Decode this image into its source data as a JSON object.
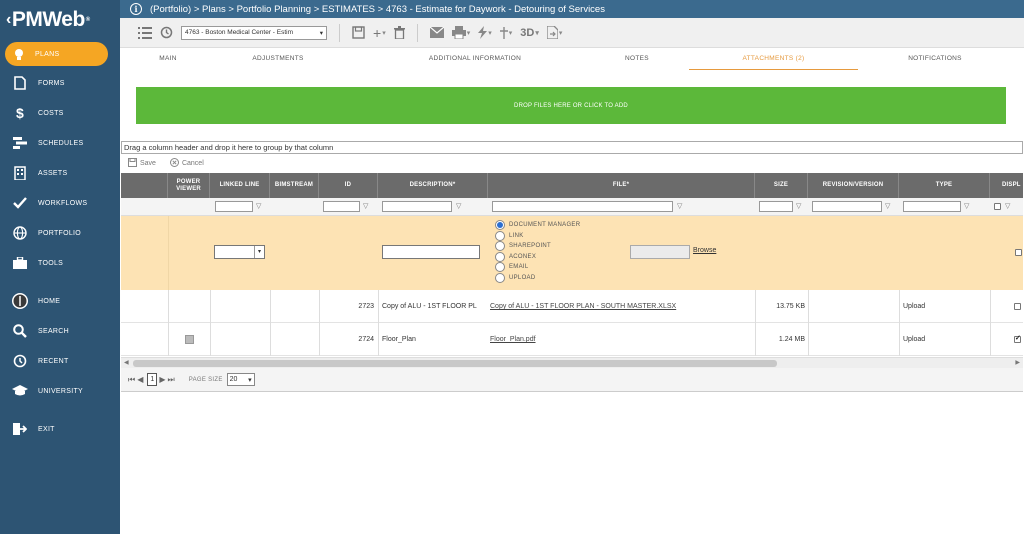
{
  "app": {
    "logo_prefix": "‹",
    "logo_text": "PMWeb",
    "logo_mark": "®"
  },
  "breadcrumb": "(Portfolio) > Plans > Portfolio Planning > ESTIMATES > 4763 - Estimate for Daywork - Detouring of Services",
  "sidebar": {
    "items": [
      {
        "label": "PLANS",
        "icon": "lightbulb-icon",
        "active": true
      },
      {
        "label": "FORMS",
        "icon": "document-icon"
      },
      {
        "label": "COSTS",
        "icon": "dollar-icon"
      },
      {
        "label": "SCHEDULES",
        "icon": "gantt-icon"
      },
      {
        "label": "ASSETS",
        "icon": "building-icon"
      },
      {
        "label": "WORKFLOWS",
        "icon": "checkmark-icon"
      },
      {
        "label": "PORTFOLIO",
        "icon": "globe-icon"
      },
      {
        "label": "TOOLS",
        "icon": "toolbox-icon"
      },
      {
        "label": "HOME",
        "icon": "avatar-icon"
      },
      {
        "label": "SEARCH",
        "icon": "search-icon"
      },
      {
        "label": "RECENT",
        "icon": "history-icon"
      },
      {
        "label": "UNIVERSITY",
        "icon": "graduation-cap-icon"
      },
      {
        "label": "EXIT",
        "icon": "exit-icon"
      }
    ]
  },
  "toolbar": {
    "project_value": "4763 - Boston Medical Center - Estim"
  },
  "tabs": [
    "MAIN",
    "ADJUSTMENTS",
    "ADDITIONAL INFORMATION",
    "NOTES",
    "ATTACHMENTS (2)",
    "NOTIFICATIONS"
  ],
  "dropzone_label": "DROP FILES HERE OR CLICK TO ADD",
  "grid": {
    "group_hint": "Drag a column header and drop it here to group by that column",
    "save_label": "Save",
    "cancel_label": "Cancel",
    "columns": [
      "POWER VIEWER",
      "LINKED LINE",
      "BIMSTREAM",
      "ID",
      "DESCRIPTION*",
      "FILE*",
      "SIZE",
      "REVISION/VERSION",
      "TYPE",
      "DISPL"
    ],
    "source_options": [
      "DOCUMENT MANAGER",
      "LINK",
      "SHAREPOINT",
      "ACONEX",
      "EMAIL",
      "UPLOAD"
    ],
    "browse_label": "Browse",
    "rows": [
      {
        "id": "2723",
        "description": "Copy of ALU - 1ST FLOOR PL",
        "file": "Copy of ALU - 1ST FLOOR PLAN - SOUTH MASTER.XLSX",
        "size": "13.75 KB",
        "type": "Upload",
        "display": false,
        "viewer": false
      },
      {
        "id": "2724",
        "description": "Floor_Plan",
        "file": "Floor_Plan.pdf",
        "size": "1.24 MB",
        "type": "Upload",
        "display": true,
        "viewer": true
      }
    ],
    "page": "1",
    "page_size_label": "PAGE SIZE",
    "page_size": "20"
  }
}
